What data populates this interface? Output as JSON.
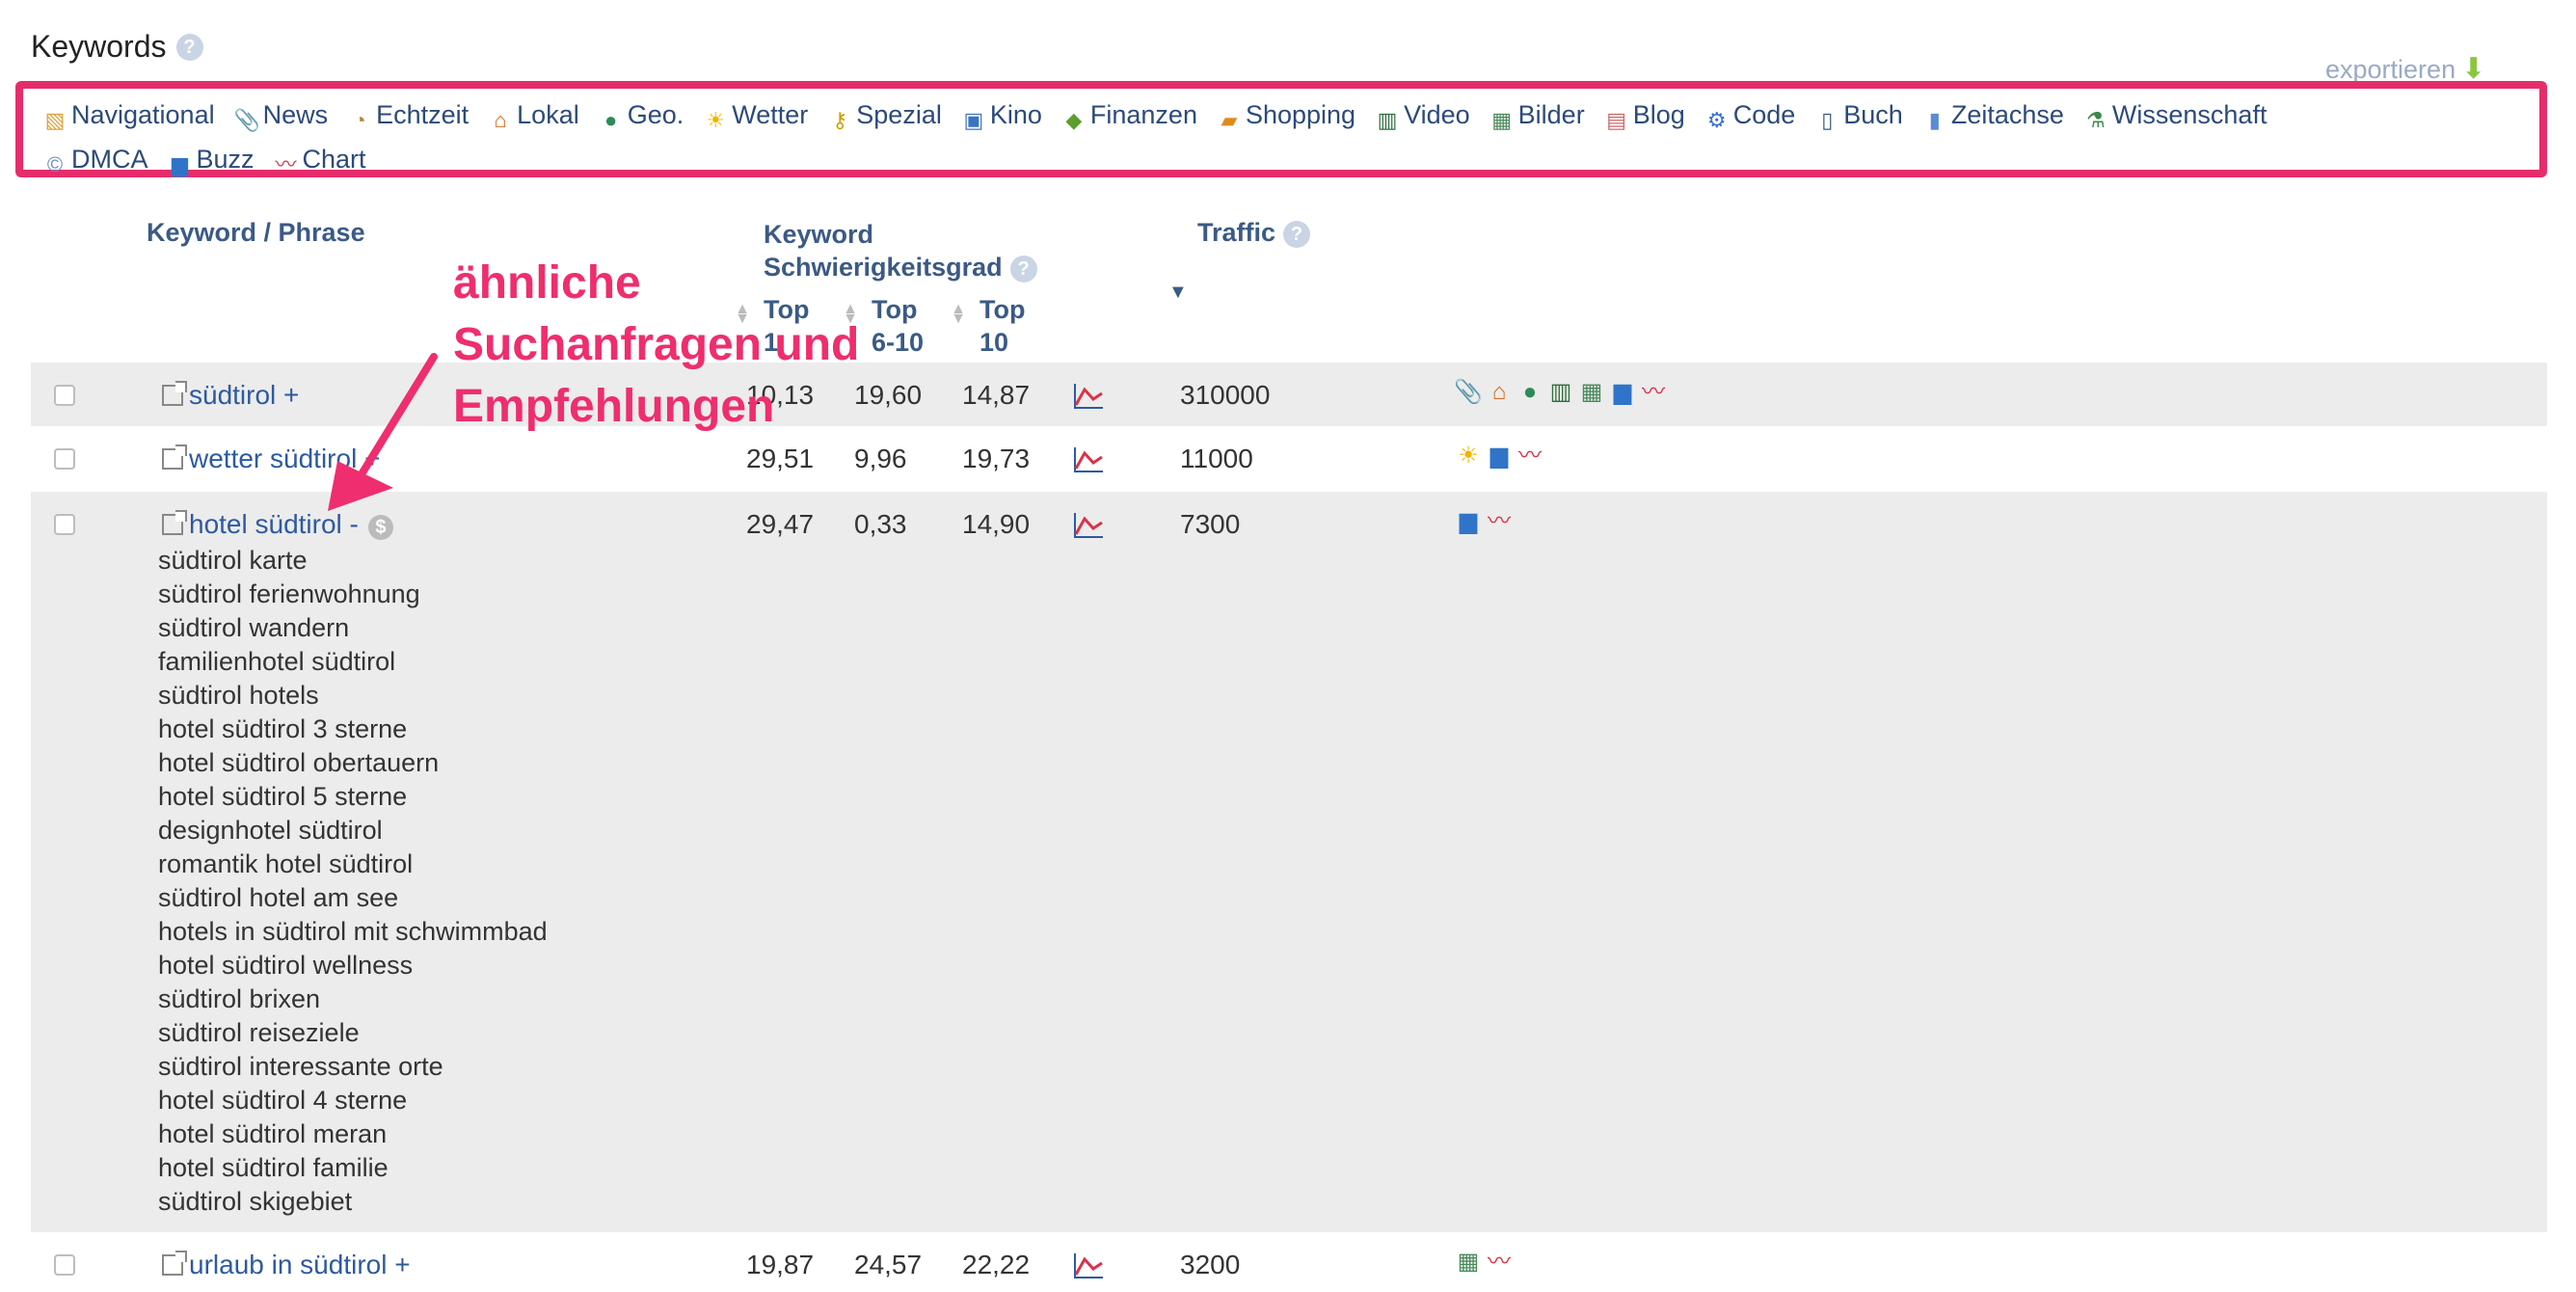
{
  "section": {
    "title": "Keywords",
    "export_label": "exportieren"
  },
  "filters": {
    "row1": [
      {
        "label": "Navigational",
        "icon": "map-icon"
      },
      {
        "label": "News",
        "icon": "paperclip-icon"
      },
      {
        "label": "Echtzeit",
        "icon": "clock-icon"
      },
      {
        "label": "Lokal",
        "icon": "house-icon"
      },
      {
        "label": "Geo.",
        "icon": "globe-icon"
      },
      {
        "label": "Wetter",
        "icon": "weather-icon"
      },
      {
        "label": "Spezial",
        "icon": "key-icon"
      },
      {
        "label": "Kino",
        "icon": "tv-icon"
      },
      {
        "label": "Finanzen",
        "icon": "money-icon"
      },
      {
        "label": "Shopping",
        "icon": "shopping-bag-icon"
      },
      {
        "label": "Video",
        "icon": "film-icon"
      },
      {
        "label": "Bilder",
        "icon": "image-icon"
      },
      {
        "label": "Blog",
        "icon": "document-icon"
      },
      {
        "label": "Code",
        "icon": "code-icon"
      },
      {
        "label": "Buch",
        "icon": "book-icon"
      },
      {
        "label": "Zeitachse",
        "icon": "timeline-icon"
      },
      {
        "label": "Wissenschaft",
        "icon": "flask-icon"
      }
    ],
    "row2": [
      {
        "label": "DMCA",
        "icon": "copyright-icon"
      },
      {
        "label": "Buzz",
        "icon": "bar-chart-icon"
      },
      {
        "label": "Chart",
        "icon": "line-chart-icon"
      }
    ]
  },
  "table": {
    "headers": {
      "keyword": "Keyword / Phrase",
      "difficulty_line1": "Keyword",
      "difficulty_line2": "Schwierigkeitsgrad",
      "top1_a": "Top",
      "top1_b": "1",
      "top610_a": "Top",
      "top610_b": "6-10",
      "top10_a": "Top",
      "top10_b": "10",
      "traffic": "Traffic"
    },
    "rows": [
      {
        "keyword": "südtirol",
        "suffix": "+",
        "top1": "10,13",
        "top610": "19,60",
        "top10": "14,87",
        "traffic": "310000",
        "icons": [
          "paperclip-icon",
          "house-icon",
          "globe-icon",
          "film-icon",
          "image-icon",
          "bar-chart-icon",
          "line-chart-icon"
        ]
      },
      {
        "keyword": "wetter südtirol",
        "suffix": "+",
        "top1": "29,51",
        "top610": "9,96",
        "top10": "19,73",
        "traffic": "11000",
        "icons": [
          "weather-icon",
          "bar-chart-icon",
          "line-chart-icon"
        ]
      },
      {
        "keyword": "hotel südtirol",
        "suffix": "-",
        "top1": "29,47",
        "top610": "0,33",
        "top10": "14,90",
        "traffic": "7300",
        "icons": [
          "bar-chart-icon",
          "line-chart-icon"
        ],
        "suggestions": [
          "südtirol karte",
          "südtirol ferienwohnung",
          "südtirol wandern",
          "familienhotel südtirol",
          "südtirol hotels",
          "hotel südtirol 3 sterne",
          "hotel südtirol obertauern",
          "hotel südtirol 5 sterne",
          "designhotel südtirol",
          "romantik hotel südtirol",
          "südtirol hotel am see",
          "hotels in südtirol mit schwimmbad",
          "hotel südtirol wellness",
          "südtirol brixen",
          "südtirol reiseziele",
          "südtirol interessante orte",
          "hotel südtirol 4 sterne",
          "hotel südtirol meran",
          "hotel südtirol familie",
          "südtirol skigebiet"
        ]
      },
      {
        "keyword": "urlaub in südtirol",
        "suffix": "+",
        "top1": "19,87",
        "top610": "24,57",
        "top10": "22,22",
        "traffic": "3200",
        "icons": [
          "image-icon",
          "line-chart-icon"
        ]
      }
    ]
  },
  "annotation": {
    "line1": "ähnliche",
    "line2": "Suchanfragen und",
    "line3": "Empfehlungen"
  },
  "colors": {
    "accent": "#e62d6b",
    "link": "#2d5aa0",
    "header": "#3b5a85",
    "row_shade": "#ececec"
  }
}
